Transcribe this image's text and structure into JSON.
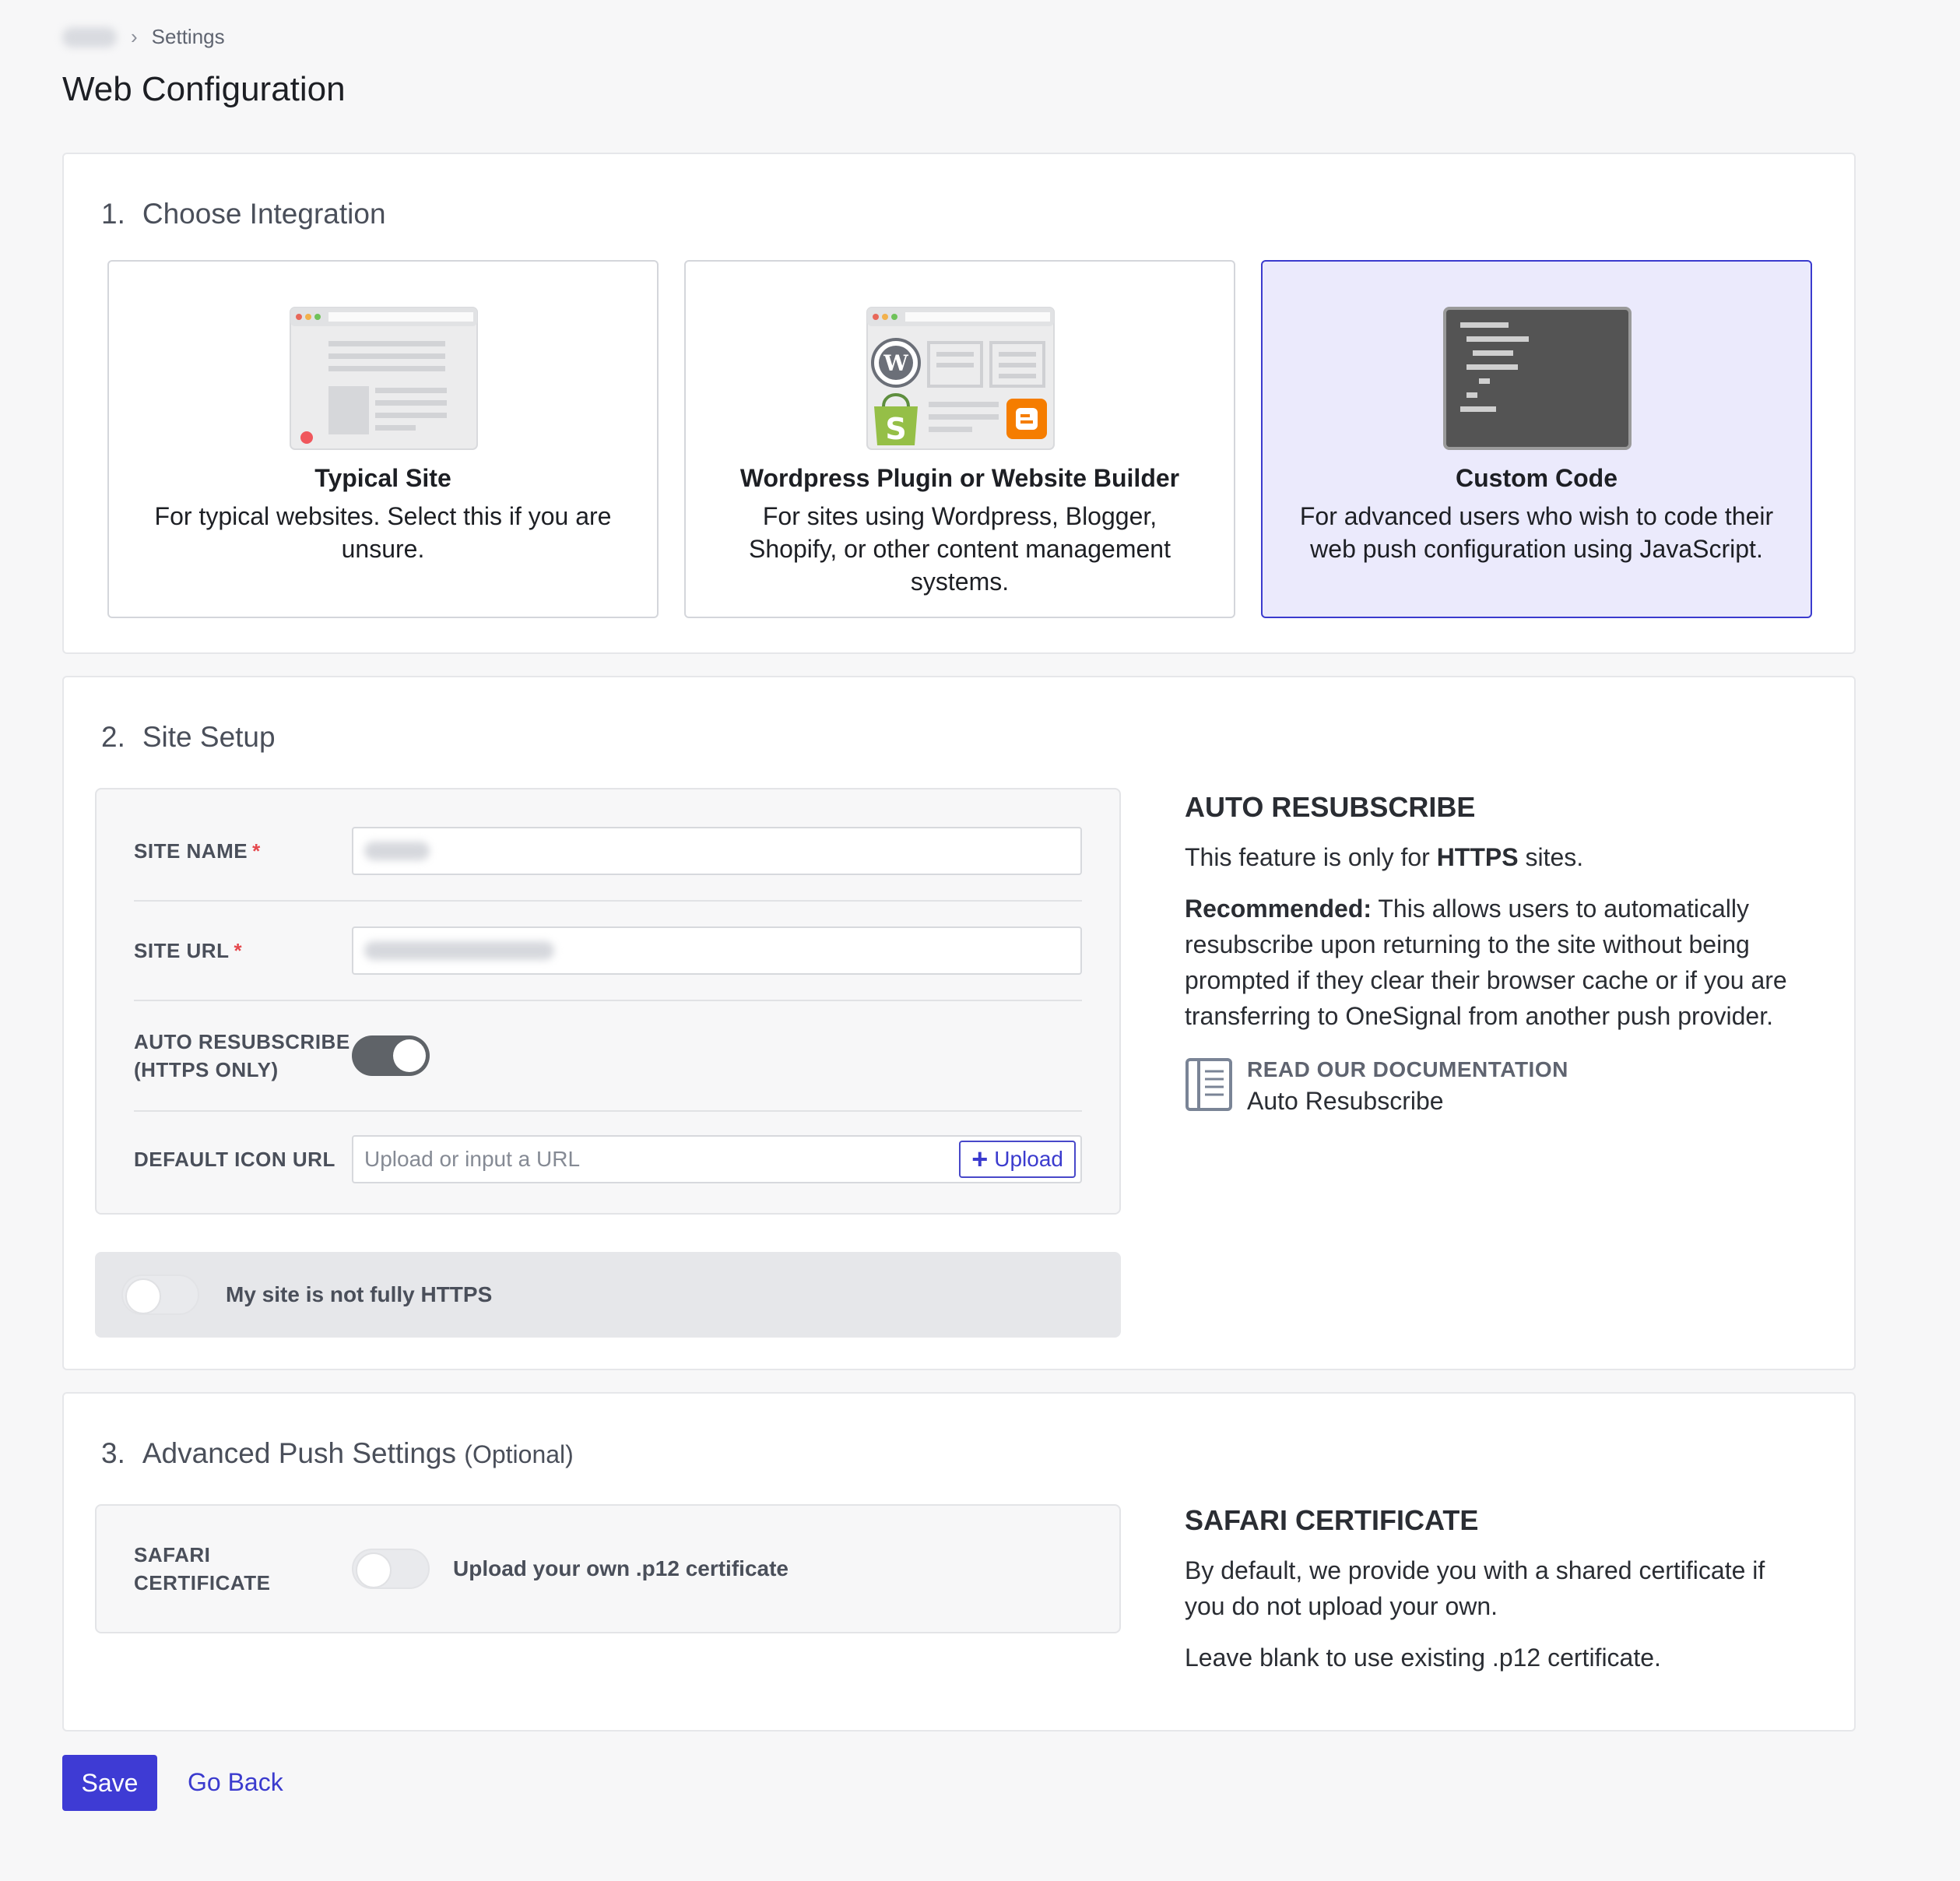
{
  "breadcrumb": {
    "current": "Settings",
    "separator": "›"
  },
  "page_title": "Web Configuration",
  "sections": {
    "integration": {
      "number": "1.",
      "title": "Choose Integration",
      "options": [
        {
          "title": "Typical Site",
          "description": "For typical websites. Select this if you are unsure.",
          "selected": false
        },
        {
          "title": "Wordpress Plugin or Website Builder",
          "description": "For sites using Wordpress, Blogger, Shopify, or other content management systems.",
          "selected": false
        },
        {
          "title": "Custom Code",
          "description": "For advanced users who wish to code their web push configuration using JavaScript.",
          "selected": true
        }
      ]
    },
    "site_setup": {
      "number": "2.",
      "title": "Site Setup",
      "fields": {
        "site_name_label": "SITE NAME",
        "site_url_label": "SITE URL",
        "required_mark": "*",
        "auto_resubscribe_label_line1": "AUTO RESUBSCRIBE",
        "auto_resubscribe_label_line2": "(HTTPS ONLY)",
        "auto_resubscribe_on": true,
        "default_icon_label": "DEFAULT ICON URL",
        "default_icon_placeholder": "Upload or input a URL",
        "upload_label": "Upload"
      },
      "https_toggle_label": "My site is not fully HTTPS",
      "https_toggle_on": false,
      "help": {
        "title": "AUTO RESUBSCRIBE",
        "line1_prefix": "This feature is only for ",
        "line1_bold": "HTTPS",
        "line1_suffix": " sites.",
        "recommended_label": "Recommended:",
        "recommended_text": " This allows users to automatically resubscribe upon returning to the site without being prompted if they clear their browser cache or if you are transferring to OneSignal from another push provider.",
        "doc_eyebrow": "READ OUR DOCUMENTATION",
        "doc_link": "Auto Resubscribe"
      }
    },
    "advanced": {
      "number": "3.",
      "title": "Advanced Push Settings",
      "optional": "(Optional)",
      "safari_label": "SAFARI CERTIFICATE",
      "safari_toggle_on": false,
      "safari_toggle_text": "Upload your own .p12 certificate",
      "help": {
        "title": "SAFARI CERTIFICATE",
        "para1": "By default, we provide you with a shared certificate if you do not upload your own.",
        "para2": "Leave blank to use existing .p12 certificate."
      }
    }
  },
  "actions": {
    "save": "Save",
    "go_back": "Go Back"
  },
  "colors": {
    "accent": "#3e3bd4",
    "selected_tile_bg": "#ebeafc",
    "required": "#e5484d"
  }
}
